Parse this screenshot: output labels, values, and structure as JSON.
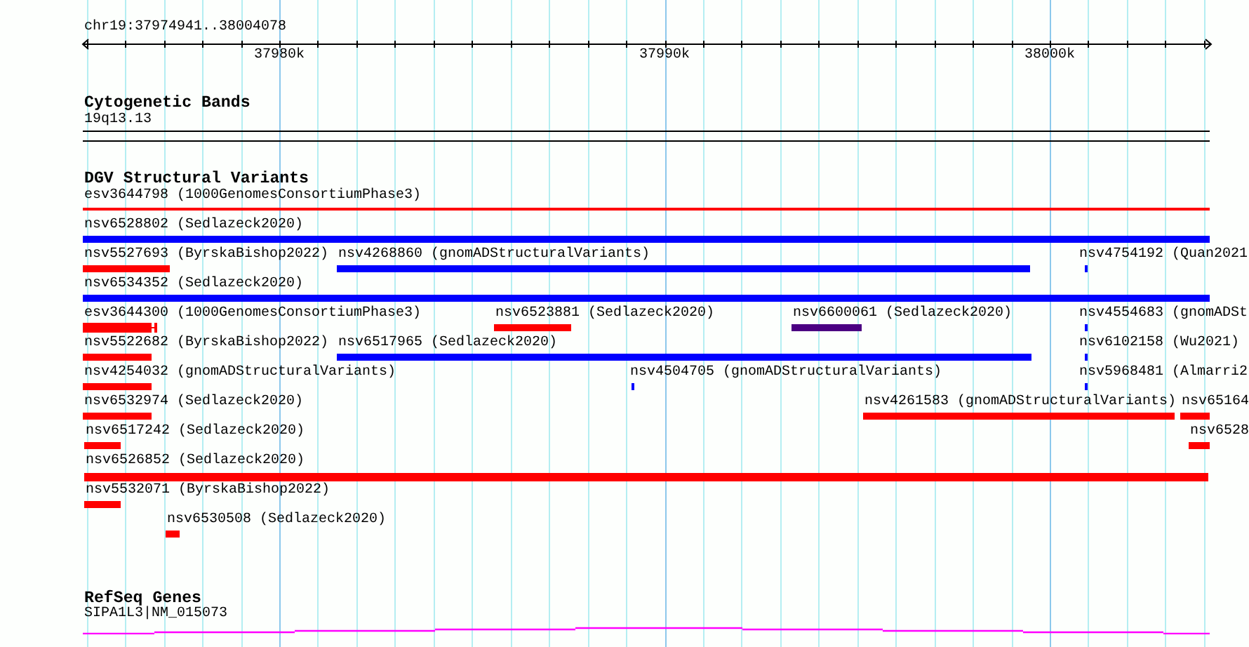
{
  "ruler": {
    "location": "chr19:37974941..38004078",
    "tick_labels": [
      "37980k",
      "37990k",
      "38000k"
    ]
  },
  "tracks": [
    {
      "kind": "bands",
      "title": "Cytogenetic Bands",
      "features": [
        {
          "label": "19q13.13"
        }
      ]
    },
    {
      "kind": "variants",
      "title": "DGV Structural Variants",
      "features": [
        {
          "label": "esv3644798 (1000GenomesConsortiumPhase3)",
          "color": "#ff0000"
        },
        {
          "label": "nsv6528802 (Sedlazeck2020)",
          "color": "#0000ff"
        },
        {
          "label": "nsv5527693 (ByrskaBishop2022)",
          "color": "#ff0000"
        },
        {
          "label": "nsv4268860 (gnomADStructuralVariants)",
          "color": "#0000ff"
        },
        {
          "label": "nsv4754192 (Quan2021",
          "color": "#0000ff"
        },
        {
          "label": "nsv6534352 (Sedlazeck2020)",
          "color": "#0000ff"
        },
        {
          "label": "esv3644300 (1000GenomesConsortiumPhase3)",
          "color": "#ff0000"
        },
        {
          "label": "nsv6523881 (Sedlazeck2020)",
          "color": "#ff0000"
        },
        {
          "label": "nsv6600061 (Sedlazeck2020)",
          "color": "#4b0082"
        },
        {
          "label": "nsv4554683 (gnomADSt",
          "color": "#0000ff"
        },
        {
          "label": "nsv5522682 (ByrskaBishop2022)",
          "color": "#ff0000"
        },
        {
          "label": "nsv6517965 (Sedlazeck2020)",
          "color": "#0000ff"
        },
        {
          "label": "nsv6102158 (Wu2021)",
          "color": "#0000ff"
        },
        {
          "label": "nsv4254032 (gnomADStructuralVariants)",
          "color": "#ff0000"
        },
        {
          "label": "nsv4504705 (gnomADStructuralVariants)",
          "color": "#0000ff"
        },
        {
          "label": "nsv5968481 (Almarri2",
          "color": "#0000ff"
        },
        {
          "label": "nsv6532974 (Sedlazeck2020)",
          "color": "#ff0000"
        },
        {
          "label": "nsv4261583 (gnomADStructuralVariants)",
          "color": "#ff0000"
        },
        {
          "label": "nsv65164",
          "color": "#ff0000"
        },
        {
          "label": "nsv6517242 (Sedlazeck2020)",
          "color": "#ff0000"
        },
        {
          "label": "nsv6528",
          "color": "#ff0000"
        },
        {
          "label": "nsv6526852 (Sedlazeck2020)",
          "color": "#ff0000"
        },
        {
          "label": "nsv5532071 (ByrskaBishop2022)",
          "color": "#ff0000"
        },
        {
          "label": "nsv6530508 (Sedlazeck2020)",
          "color": "#ff0000"
        }
      ]
    },
    {
      "kind": "genes",
      "title": "RefSeq Genes",
      "features": [
        {
          "label": "SIPA1L3|NM_015073"
        }
      ]
    }
  ]
}
